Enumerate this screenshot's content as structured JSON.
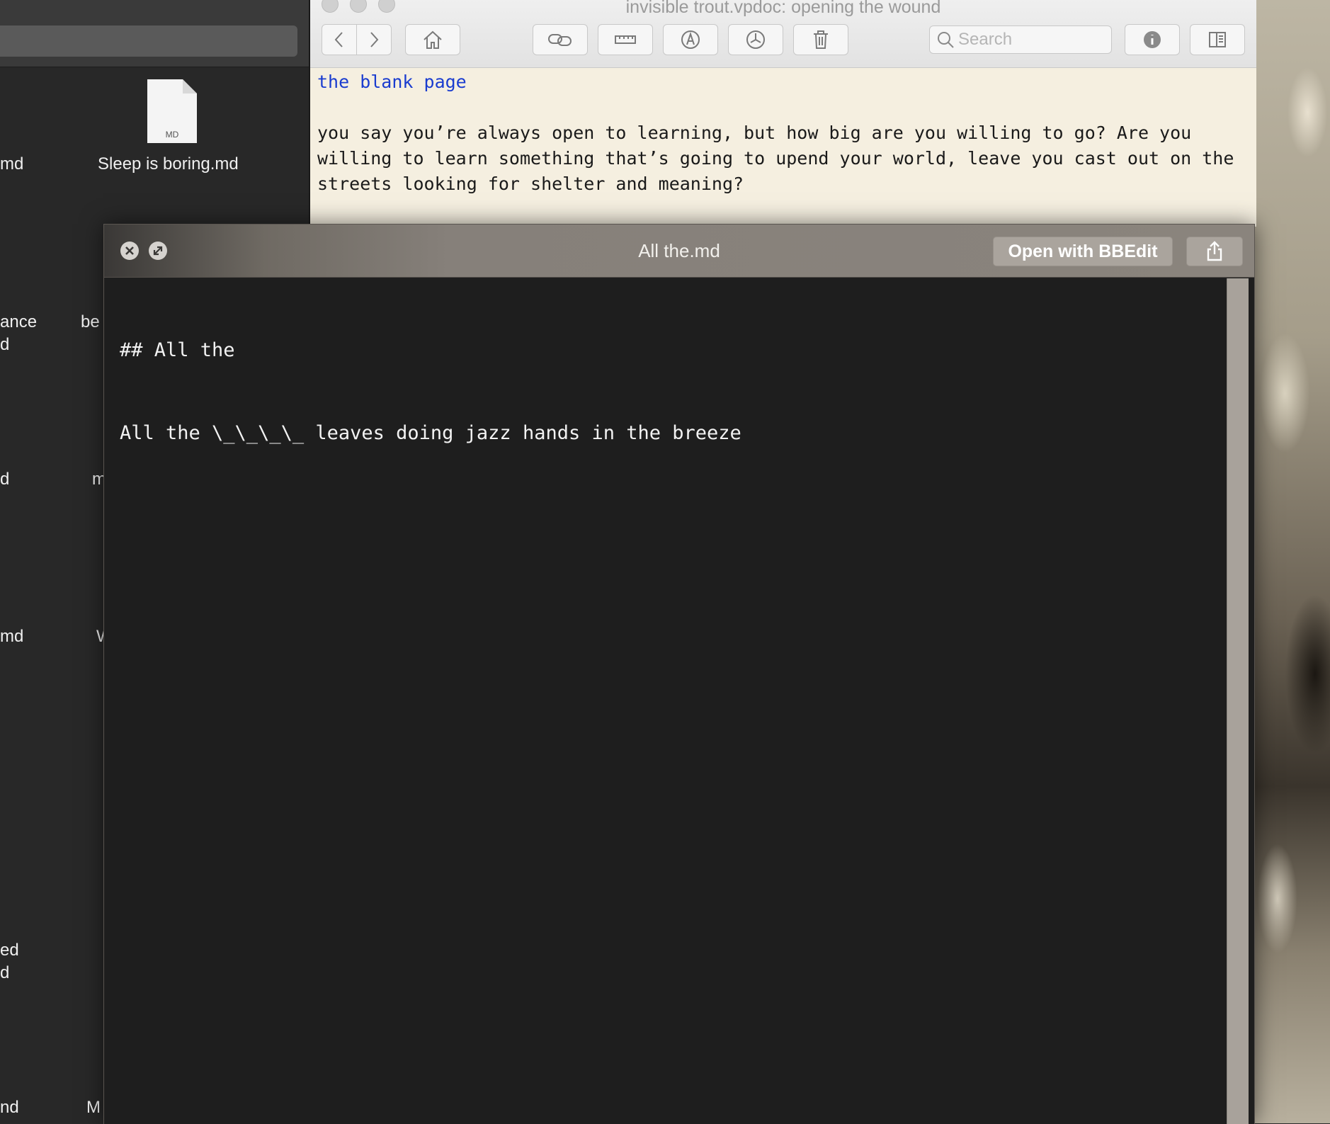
{
  "finder": {
    "files": [
      {
        "label": "md"
      },
      {
        "label": "Sleep is boring.md",
        "badge": "MD"
      },
      {
        "label": "ance"
      },
      {
        "label": "d"
      },
      {
        "label": "be"
      },
      {
        "label": "d"
      },
      {
        "label": "m"
      },
      {
        "label": "md"
      },
      {
        "label": "W"
      },
      {
        "label": "ed"
      },
      {
        "label": "d"
      },
      {
        "label": "nd"
      },
      {
        "label": "M"
      }
    ]
  },
  "notes_window": {
    "title": "invisible trout.vpdoc: opening the wound",
    "search_placeholder": "Search",
    "heading": "the blank page",
    "paragraph_lines": [
      "you say you’re always open to learning, but how big are you willing to go? Are you",
      "willing to learn something that’s going to upend your world, leave you cast out on the",
      "streets looking for shelter and meaning?"
    ],
    "toolbar_icons": [
      "back-icon",
      "forward-icon",
      "home-icon",
      "link-icon",
      "ruler-icon",
      "pen-icon",
      "clock-icon",
      "trash-icon",
      "info-icon",
      "sidebar-icon"
    ]
  },
  "quicklook": {
    "title": "All the.md",
    "open_with_label": "Open with BBEdit",
    "content_lines": [
      "## All the",
      "All the \\_\\_\\_\\_ leaves doing jazz hands in the breeze"
    ]
  }
}
